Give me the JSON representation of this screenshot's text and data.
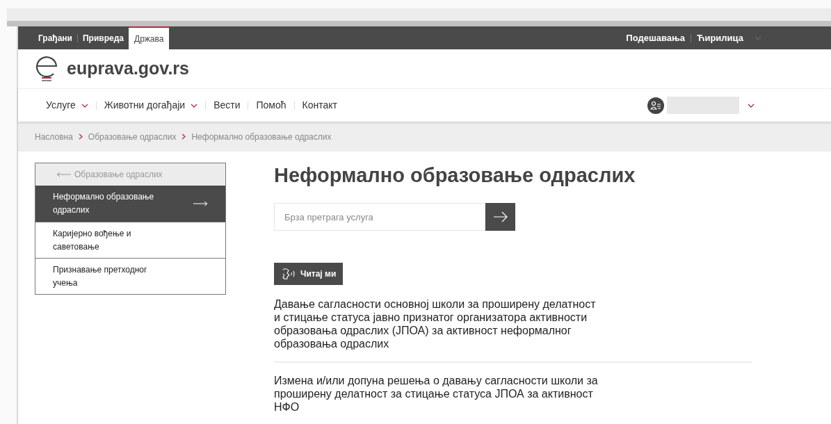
{
  "top_bar": {
    "tabs": [
      {
        "label": "Грађани",
        "selected": false
      },
      {
        "label": "Привреда",
        "selected": false
      },
      {
        "label": "Држава",
        "selected": true
      }
    ],
    "settings": "Подешавања",
    "language": "Ћирилица"
  },
  "logo": {
    "text": "euprava.gov.rs"
  },
  "nav": {
    "items": [
      {
        "label": "Услуге",
        "has_dropdown": true
      },
      {
        "label": "Животни догађаји",
        "has_dropdown": true
      },
      {
        "label": "Вести",
        "has_dropdown": false
      },
      {
        "label": "Помоћ",
        "has_dropdown": false
      },
      {
        "label": "Контакт",
        "has_dropdown": false
      }
    ]
  },
  "breadcrumb": [
    "Насловна",
    "Образовање одраслих",
    "Неформално образовање одраслих"
  ],
  "sidebar": {
    "back": "Образовање одраслих",
    "items": [
      {
        "label": "Неформално образовање одраслих",
        "selected": true
      },
      {
        "label": "Каријерно вођење и саветовање",
        "selected": false
      },
      {
        "label": "Признавање претходног учења",
        "selected": false
      }
    ]
  },
  "page_title": "Неформално образовање одраслих",
  "search": {
    "placeholder": "Брза претрага услуга"
  },
  "read_button": "Читај ми",
  "services": [
    "Давање сагласности основној школи за проширену делатност и стицање статуса јавно признатог организатора активности образовања одраслих (ЈПОА) за активност неформалног образовања одраслих",
    "Измена и/или допуна решења о давању сагласности школи за проширену делатност за стицање статуса ЈПОА за активност НФО"
  ]
}
